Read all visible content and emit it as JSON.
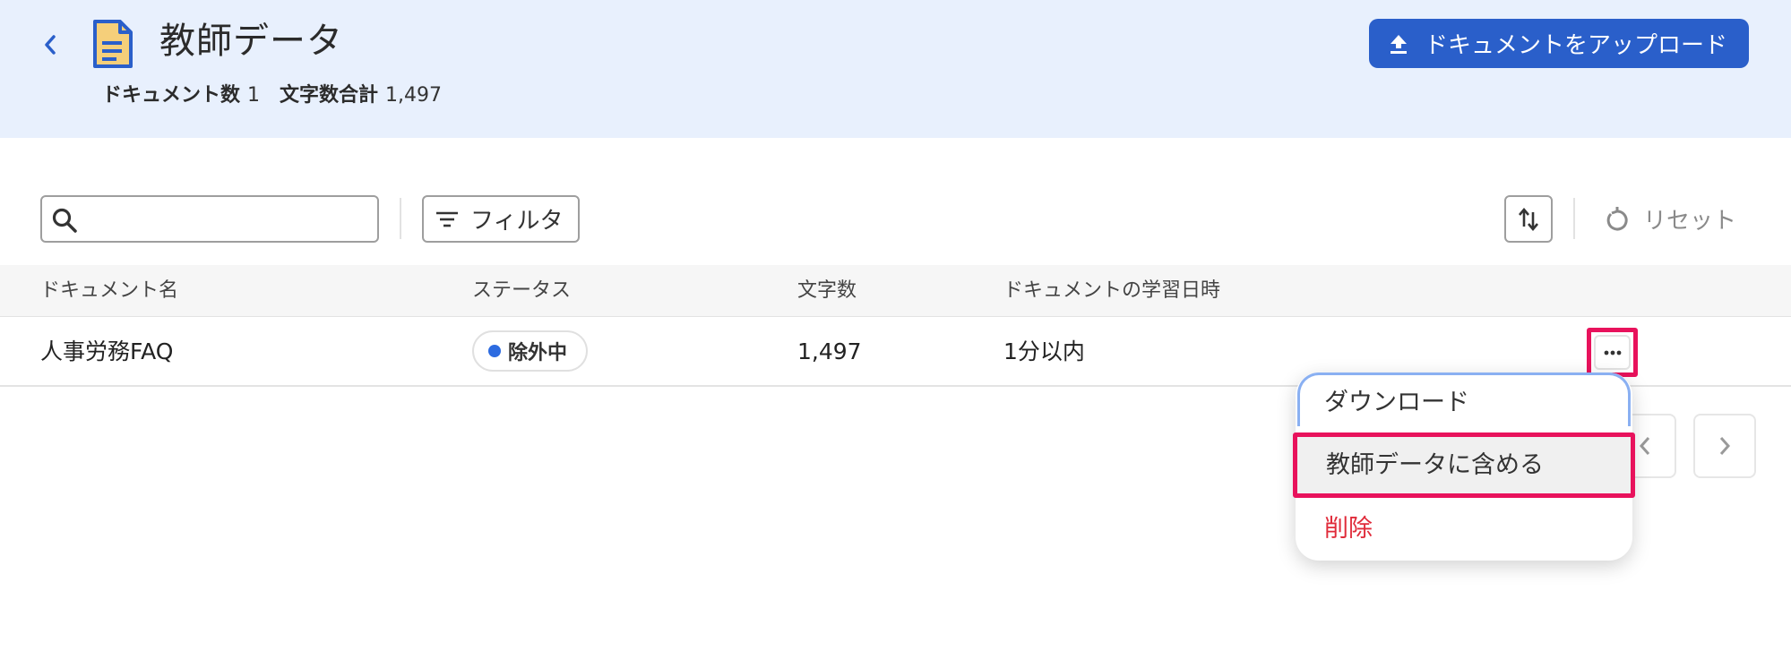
{
  "header": {
    "title": "教師データ",
    "stats": {
      "documents_label": "ドキュメント数",
      "documents_value": "1",
      "chars_label": "文字数合計",
      "chars_value": "1,497"
    },
    "upload_button": "ドキュメントをアップロード",
    "accent_color": "#2a5fca",
    "background_color": "#e8f0fd",
    "icons": [
      "chevron-left-icon",
      "document-icon",
      "upload-icon"
    ]
  },
  "toolbar": {
    "search_placeholder": "",
    "filter_label": "フィルタ",
    "reset_label": "リセット",
    "icons": [
      "search-icon",
      "filter-icon",
      "sort-icon",
      "reset-icon"
    ]
  },
  "table": {
    "columns": [
      "ドキュメント名",
      "ステータス",
      "文字数",
      "ドキュメントの学習日時"
    ],
    "rows": [
      {
        "name": "人事労務FAQ",
        "status": "除外中",
        "chars": "1,497",
        "learned_at": "1分以内"
      }
    ],
    "status_dot_color": "#2d6be0"
  },
  "menu": {
    "items": [
      {
        "label": "ダウンロード"
      },
      {
        "label": "教師データに含める"
      },
      {
        "label": "削除"
      }
    ],
    "highlight_color": "#e8125c",
    "danger_color": "#e02b3a"
  }
}
